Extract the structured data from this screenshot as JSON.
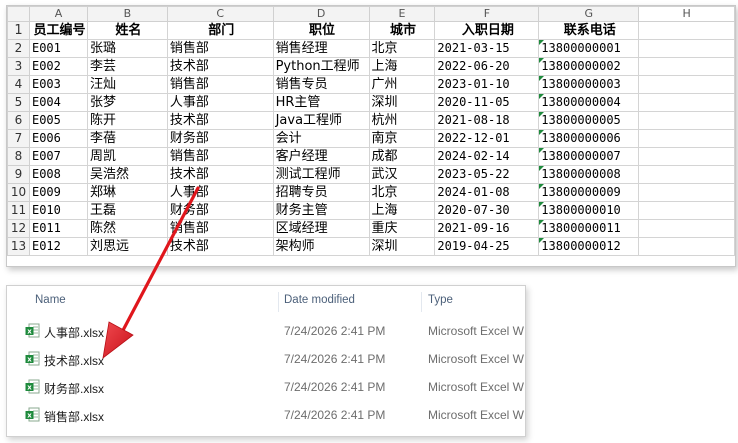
{
  "spreadsheet": {
    "col_letters": [
      "A",
      "B",
      "C",
      "D",
      "E",
      "F",
      "G",
      "H"
    ],
    "headers": [
      "员工编号",
      "姓名",
      "部门",
      "职位",
      "城市",
      "入职日期",
      "联系电话"
    ],
    "rows": [
      [
        "E001",
        "张璐",
        "销售部",
        "销售经理",
        "北京",
        "2021-03-15",
        "13800000001"
      ],
      [
        "E002",
        "李芸",
        "技术部",
        "Python工程师",
        "上海",
        "2022-06-20",
        "13800000002"
      ],
      [
        "E003",
        "汪灿",
        "销售部",
        "销售专员",
        "广州",
        "2023-01-10",
        "13800000003"
      ],
      [
        "E004",
        "张梦",
        "人事部",
        "HR主管",
        "深圳",
        "2020-11-05",
        "13800000004"
      ],
      [
        "E005",
        "陈开",
        "技术部",
        "Java工程师",
        "杭州",
        "2021-08-18",
        "13800000005"
      ],
      [
        "E006",
        "李蓓",
        "财务部",
        "会计",
        "南京",
        "2022-12-01",
        "13800000006"
      ],
      [
        "E007",
        "周凯",
        "销售部",
        "客户经理",
        "成都",
        "2024-02-14",
        "13800000007"
      ],
      [
        "E008",
        "吴浩然",
        "技术部",
        "测试工程师",
        "武汉",
        "2023-05-22",
        "13800000008"
      ],
      [
        "E009",
        "郑琳",
        "人事部",
        "招聘专员",
        "北京",
        "2024-01-08",
        "13800000009"
      ],
      [
        "E010",
        "王磊",
        "财务部",
        "财务主管",
        "上海",
        "2020-07-30",
        "13800000010"
      ],
      [
        "E011",
        "陈然",
        "销售部",
        "区域经理",
        "重庆",
        "2021-09-16",
        "13800000011"
      ],
      [
        "E012",
        "刘思远",
        "技术部",
        "架构师",
        "深圳",
        "2019-04-25",
        "13800000012"
      ]
    ],
    "row_numbers": [
      "1",
      "2",
      "3",
      "4",
      "5",
      "6",
      "7",
      "8",
      "9",
      "10",
      "11",
      "12",
      "13"
    ]
  },
  "explorer": {
    "columns": {
      "name": "Name",
      "date": "Date modified",
      "type": "Type"
    },
    "files": [
      {
        "name": "人事部.xlsx",
        "date": "7/24/2026 2:41 PM",
        "type": "Microsoft Excel W"
      },
      {
        "name": "技术部.xlsx",
        "date": "7/24/2026 2:41 PM",
        "type": "Microsoft Excel W"
      },
      {
        "name": "财务部.xlsx",
        "date": "7/24/2026 2:41 PM",
        "type": "Microsoft Excel W"
      },
      {
        "name": "销售部.xlsx",
        "date": "7/24/2026 2:41 PM",
        "type": "Microsoft Excel W"
      }
    ]
  },
  "colors": {
    "arrow": "#e0161c",
    "excel_green": "#1e8a3c",
    "cell_marker": "#1e8a3c"
  },
  "icons": {
    "file": "excel-file-icon",
    "arrow": "red-arrow-annotation"
  }
}
